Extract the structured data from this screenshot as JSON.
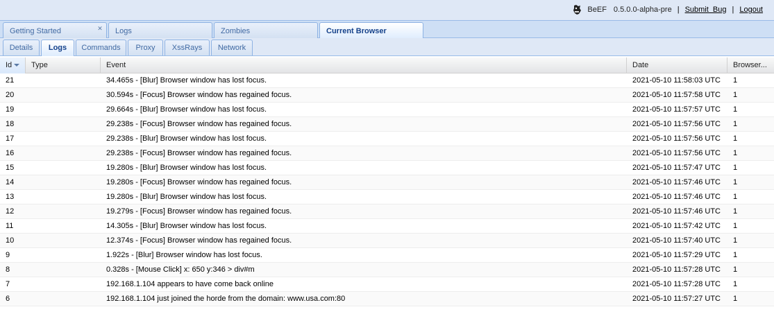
{
  "header": {
    "app_name": "BeEF",
    "version": "0.5.0.0-alpha-pre",
    "separator": "|",
    "submit_bug": "Submit  Bug",
    "logout": "Logout",
    "logo_icon": "beef-cow-icon"
  },
  "main_tabs": [
    {
      "label": "Getting Started",
      "closable": true,
      "active": false
    },
    {
      "label": "Logs",
      "closable": false,
      "active": false
    },
    {
      "label": "Zombies",
      "closable": false,
      "active": false
    },
    {
      "label": "Current Browser",
      "closable": false,
      "active": true
    }
  ],
  "sub_tabs": [
    {
      "label": "Details",
      "active": false
    },
    {
      "label": "Logs",
      "active": true
    },
    {
      "label": "Commands",
      "active": false
    },
    {
      "label": "Proxy",
      "active": false
    },
    {
      "label": "XssRays",
      "active": false
    },
    {
      "label": "Network",
      "active": false
    }
  ],
  "grid": {
    "columns": [
      "Id",
      "Type",
      "Event",
      "Date",
      "Browser..."
    ],
    "sorted_column": "Id",
    "rows": [
      {
        "id": "21",
        "type": "",
        "event": "34.465s - [Blur] Browser window has lost focus.",
        "date": "2021-05-10 11:58:03 UTC",
        "browser": "1"
      },
      {
        "id": "20",
        "type": "",
        "event": "30.594s - [Focus] Browser window has regained focus.",
        "date": "2021-05-10 11:57:58 UTC",
        "browser": "1"
      },
      {
        "id": "19",
        "type": "",
        "event": "29.664s - [Blur] Browser window has lost focus.",
        "date": "2021-05-10 11:57:57 UTC",
        "browser": "1"
      },
      {
        "id": "18",
        "type": "",
        "event": "29.238s - [Focus] Browser window has regained focus.",
        "date": "2021-05-10 11:57:56 UTC",
        "browser": "1"
      },
      {
        "id": "17",
        "type": "",
        "event": "29.238s - [Blur] Browser window has lost focus.",
        "date": "2021-05-10 11:57:56 UTC",
        "browser": "1"
      },
      {
        "id": "16",
        "type": "",
        "event": "29.238s - [Focus] Browser window has regained focus.",
        "date": "2021-05-10 11:57:56 UTC",
        "browser": "1"
      },
      {
        "id": "15",
        "type": "",
        "event": "19.280s - [Blur] Browser window has lost focus.",
        "date": "2021-05-10 11:57:47 UTC",
        "browser": "1"
      },
      {
        "id": "14",
        "type": "",
        "event": "19.280s - [Focus] Browser window has regained focus.",
        "date": "2021-05-10 11:57:46 UTC",
        "browser": "1"
      },
      {
        "id": "13",
        "type": "",
        "event": "19.280s - [Blur] Browser window has lost focus.",
        "date": "2021-05-10 11:57:46 UTC",
        "browser": "1"
      },
      {
        "id": "12",
        "type": "",
        "event": "19.279s - [Focus] Browser window has regained focus.",
        "date": "2021-05-10 11:57:46 UTC",
        "browser": "1"
      },
      {
        "id": "11",
        "type": "",
        "event": "14.305s - [Blur] Browser window has lost focus.",
        "date": "2021-05-10 11:57:42 UTC",
        "browser": "1"
      },
      {
        "id": "10",
        "type": "",
        "event": "12.374s - [Focus] Browser window has regained focus.",
        "date": "2021-05-10 11:57:40 UTC",
        "browser": "1"
      },
      {
        "id": "9",
        "type": "",
        "event": "1.922s - [Blur] Browser window has lost focus.",
        "date": "2021-05-10 11:57:29 UTC",
        "browser": "1"
      },
      {
        "id": "8",
        "type": "",
        "event": "0.328s - [Mouse Click] x: 650 y:346 > div#m",
        "date": "2021-05-10 11:57:28 UTC",
        "browser": "1"
      },
      {
        "id": "7",
        "type": "",
        "event": "192.168.1.104 appears to have come back online",
        "date": "2021-05-10 11:57:28 UTC",
        "browser": "1"
      },
      {
        "id": "6",
        "type": "",
        "event": "192.168.1.104 just joined the horde from the domain: www.usa.com:80",
        "date": "2021-05-10 11:57:27 UTC",
        "browser": "1"
      }
    ]
  }
}
